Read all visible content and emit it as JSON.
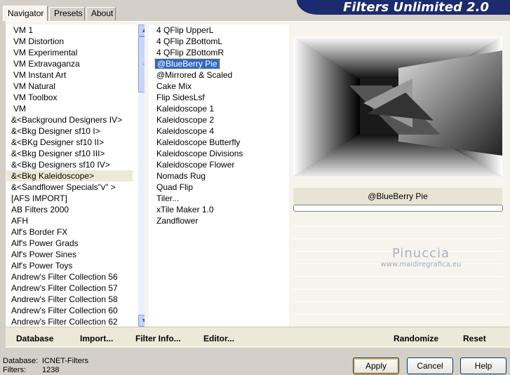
{
  "title": "Filters Unlimited 2.0",
  "tabs": [
    "Navigator",
    "Presets",
    "About"
  ],
  "categories": [
    "VM 1",
    "VM Distortion",
    "VM Experimental",
    "VM Extravaganza",
    "VM Instant Art",
    "VM Natural",
    "VM Toolbox",
    "VM",
    "&<Background Designers IV>",
    "&<Bkg Designer sf10 I>",
    "&<BKg Designer sf10 II>",
    "&<Bkg Designer sf10 III>",
    "&<Bkg Designers sf10 IV>",
    "&<Bkg Kaleidoscope>",
    "&<Sandflower Specials\"v\" >",
    "[AFS IMPORT]",
    "AB Filters 2000",
    "AFH",
    "Alf's Border FX",
    "Alf's Power Grads",
    "Alf's Power Sines",
    "Alf's Power Toys",
    "Andrew's Filter Collection 56",
    "Andrew's Filter Collection 57",
    "Andrew's Filter Collection 58",
    "Andrew's Filter Collection 60",
    "Andrew's Filter Collection 62"
  ],
  "selected_category_index": 13,
  "filters": [
    "4 QFlip UpperL",
    "4 QFlip ZBottomL",
    "4 QFlip ZBottomR",
    "@BlueBerry Pie",
    "@Mirrored & Scaled",
    "Cake Mix",
    "Flip SidesLsf",
    "Kaleidoscope 1",
    "Kaleidoscope 2",
    "Kaleidoscope 4",
    "Kaleidoscope Butterfly",
    "Kaleidoscope Divisions",
    "Kaleidoscope Flower",
    "Nomads Rug",
    "Quad Flip",
    "Tiler...",
    "xTile Maker 1.0",
    "Zandflower"
  ],
  "selected_filter_index": 3,
  "preview": {
    "effect_name": "@BlueBerry Pie"
  },
  "watermark": {
    "name": "Pinuccia",
    "url": "www.maidiregrafica.eu"
  },
  "bottom_links": {
    "database": "Database",
    "import": "Import...",
    "filter_info": "Filter Info...",
    "editor": "Editor...",
    "randomize": "Randomize",
    "reset": "Reset"
  },
  "status": {
    "database_label": "Database:",
    "database_value": "ICNET-Filters",
    "filters_label": "Filters:",
    "filters_value": "1238"
  },
  "buttons": {
    "apply": "Apply",
    "cancel": "Cancel",
    "help": "Help"
  },
  "colors": {
    "banner": "#1c2a6e",
    "selection": "#316ac5",
    "panel": "#f6f4ec"
  },
  "icons": {
    "scroll_up": "chevron-up-icon",
    "scroll_down": "chevron-down-icon"
  }
}
